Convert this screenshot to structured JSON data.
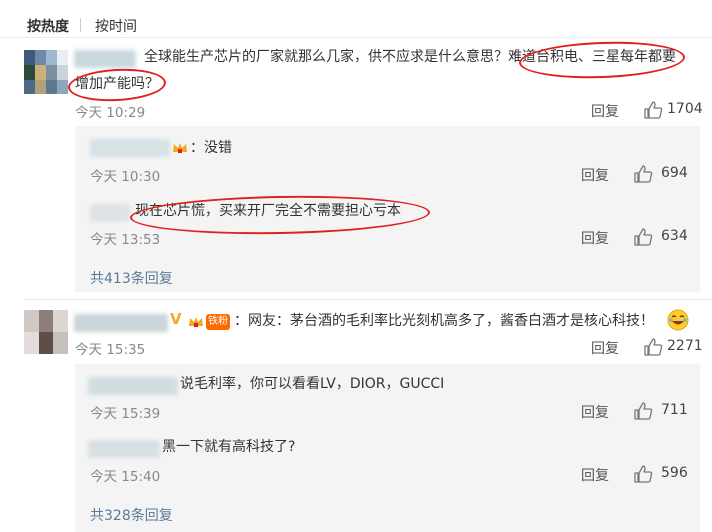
{
  "sort": {
    "hot": "按热度",
    "time": "按时间"
  },
  "comments": [
    {
      "text_line1": "全球能生产芯片的厂家就那么几家，供不应求是什么意思？难道台积电、三星每年都要",
      "text_line2": "增加产能吗？",
      "time": "今天 10:29",
      "reply_label": "回复",
      "likes": "1704",
      "replies": [
        {
          "text": "：没错",
          "time": "今天 10:30",
          "reply_label": "回复",
          "likes": "694"
        },
        {
          "text": "现在芯片慌，买来开厂完全不需要担心亏本",
          "time": "今天 13:53",
          "reply_label": "回复",
          "likes": "634"
        }
      ],
      "more_replies": "共413条回复"
    },
    {
      "verified": "V",
      "fan_badge": "铁粉",
      "text": "：网友：茅台酒的毛利率比光刻机高多了，酱香白酒才是核心科技！",
      "time": "今天 15:35",
      "reply_label": "回复",
      "likes": "2271",
      "replies": [
        {
          "text": "说毛利率，你可以看看LV，DIOR，GUCCI",
          "time": "今天 15:39",
          "reply_label": "回复",
          "likes": "711"
        },
        {
          "text": "黑一下就有高科技了?",
          "time": "今天 15:40",
          "reply_label": "回复",
          "likes": "596"
        }
      ],
      "more_replies": "共328条回复"
    }
  ],
  "icons": {
    "thumb": "thumbs-up-icon",
    "crown": "crown-icon",
    "emoji": "laughing-emoji-icon"
  },
  "colors": {
    "highlight_ring": "#e02020",
    "link": "#5b7a9a",
    "verified": "#f5a623",
    "fan_badge": "#ff6a00"
  }
}
